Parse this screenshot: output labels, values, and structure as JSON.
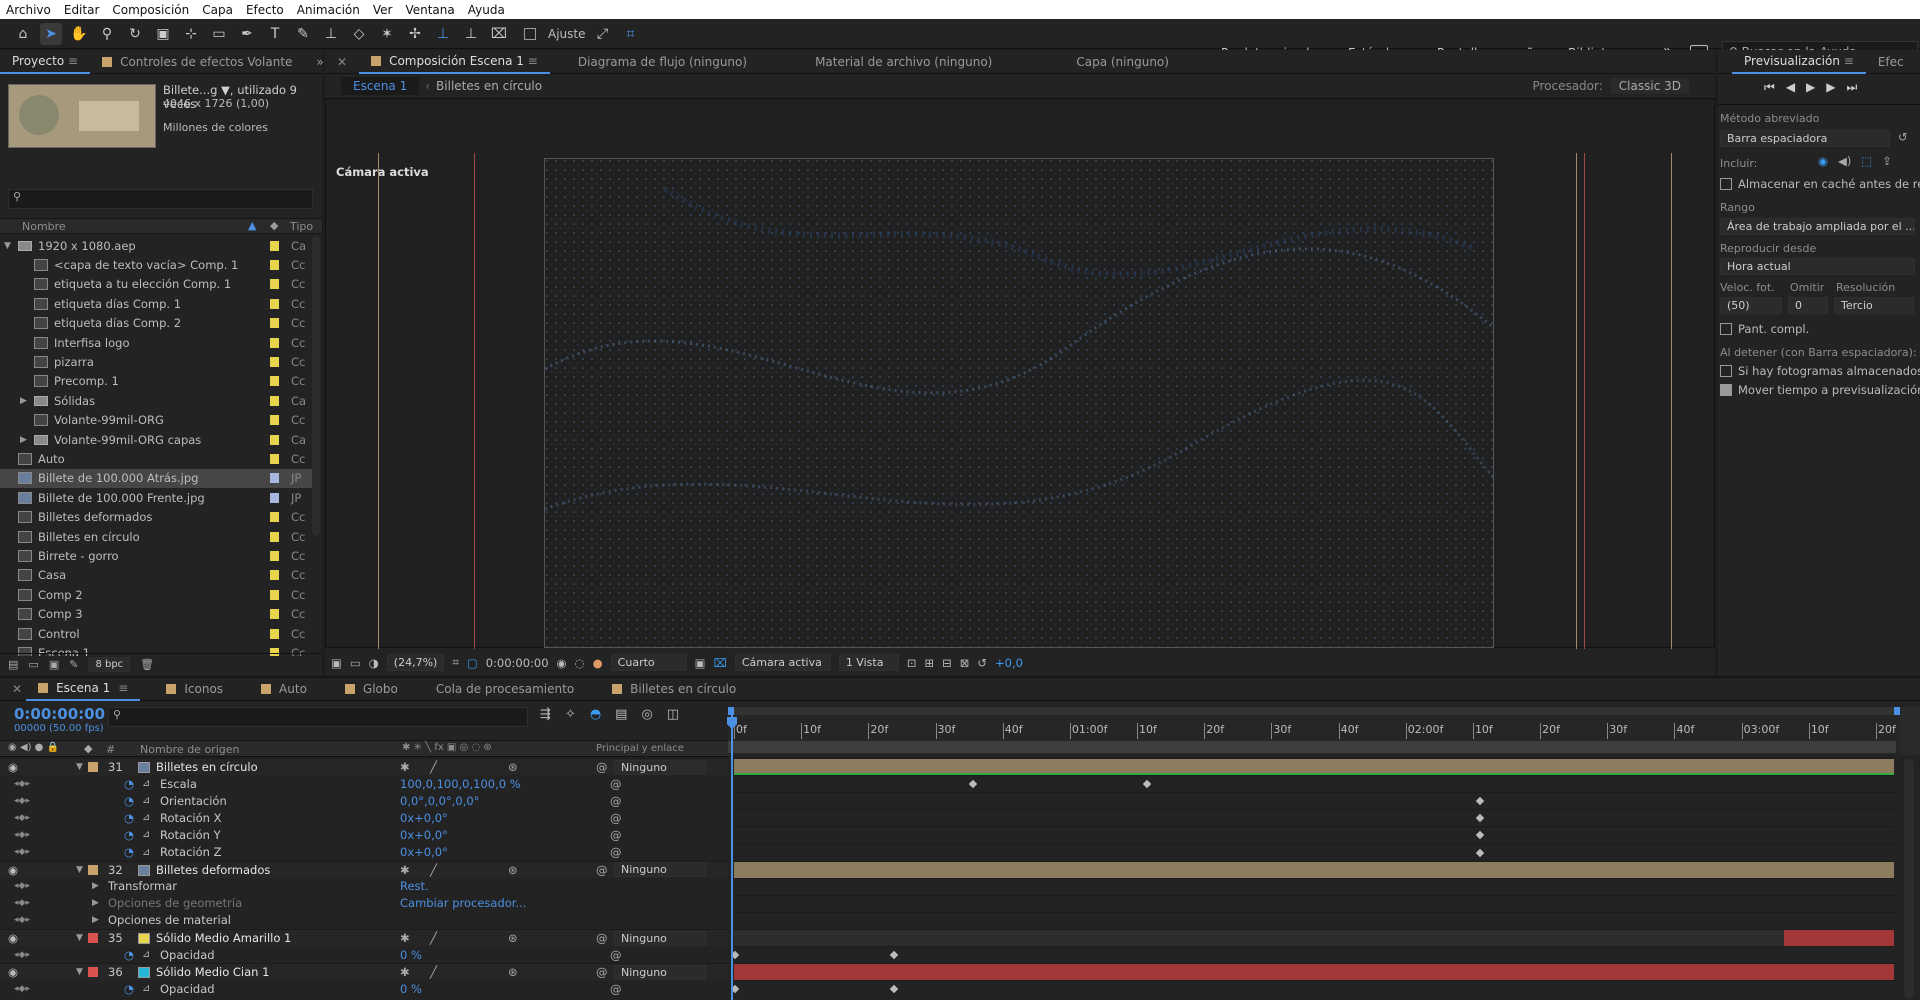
{
  "menu": [
    "Archivo",
    "Editar",
    "Composición",
    "Capa",
    "Efecto",
    "Animación",
    "Ver",
    "Ventana",
    "Ayuda"
  ],
  "toolbar": {
    "snap_label": "Ajuste",
    "workspaces": [
      "Predeterminado",
      "Estándar",
      "Pantalla pequeña",
      "Bibliotecas"
    ],
    "search_placeholder": "Buscar en la Ayuda"
  },
  "project": {
    "tabs": [
      "Proyecto",
      "Controles de efectos Volante"
    ],
    "item_name": "Billete...g ▼, utilizado 9 veces",
    "item_size": "4046 x 1726 (1,00)",
    "item_colors": "Millones de colores",
    "col_name": "Nombre",
    "col_type": "Tipo",
    "bpc": "8 bpc",
    "items": [
      {
        "name": "1920 x 1080.aep",
        "type": "Ca",
        "indent": 0,
        "kind": "folder",
        "color": "#e8d44d",
        "expand": "open"
      },
      {
        "name": "<capa de texto vacía> Comp. 1",
        "type": "Cc",
        "indent": 1,
        "kind": "comp",
        "color": "#e8d44d"
      },
      {
        "name": "etiqueta a tu elección Comp. 1",
        "type": "Cc",
        "indent": 1,
        "kind": "comp",
        "color": "#e8d44d"
      },
      {
        "name": "etiqueta días Comp. 1",
        "type": "Cc",
        "indent": 1,
        "kind": "comp",
        "color": "#e8d44d"
      },
      {
        "name": "etiqueta días Comp. 2",
        "type": "Cc",
        "indent": 1,
        "kind": "comp",
        "color": "#e8d44d"
      },
      {
        "name": "Interfisa logo",
        "type": "Cc",
        "indent": 1,
        "kind": "comp",
        "color": "#e8d44d"
      },
      {
        "name": "pizarra",
        "type": "Cc",
        "indent": 1,
        "kind": "comp",
        "color": "#e8d44d"
      },
      {
        "name": "Precomp. 1",
        "type": "Cc",
        "indent": 1,
        "kind": "comp",
        "color": "#e8d44d"
      },
      {
        "name": "Sólidas",
        "type": "Ca",
        "indent": 1,
        "kind": "folder",
        "color": "#e8d44d",
        "expand": "closed"
      },
      {
        "name": "Volante-99mil-ORG",
        "type": "Cc",
        "indent": 1,
        "kind": "comp",
        "color": "#e8d44d"
      },
      {
        "name": "Volante-99mil-ORG capas",
        "type": "Ca",
        "indent": 1,
        "kind": "folder",
        "color": "#e8d44d",
        "expand": "closed"
      },
      {
        "name": "Auto",
        "type": "Cc",
        "indent": 0,
        "kind": "comp",
        "color": "#e8d44d"
      },
      {
        "name": "Billete de 100.000 Atrás.jpg",
        "type": "JP",
        "indent": 0,
        "kind": "img",
        "color": "#a8b6e0",
        "selected": true
      },
      {
        "name": "Billete de 100.000 Frente.jpg",
        "type": "JP",
        "indent": 0,
        "kind": "img",
        "color": "#a8b6e0"
      },
      {
        "name": "Billetes deformados",
        "type": "Cc",
        "indent": 0,
        "kind": "comp",
        "color": "#e8d44d"
      },
      {
        "name": "Billetes en círculo",
        "type": "Cc",
        "indent": 0,
        "kind": "comp",
        "color": "#e8d44d"
      },
      {
        "name": "Birrete - gorro",
        "type": "Cc",
        "indent": 0,
        "kind": "comp",
        "color": "#e8d44d"
      },
      {
        "name": "Casa",
        "type": "Cc",
        "indent": 0,
        "kind": "comp",
        "color": "#e8d44d"
      },
      {
        "name": "Comp 2",
        "type": "Cc",
        "indent": 0,
        "kind": "comp",
        "color": "#e8d44d"
      },
      {
        "name": "Comp 3",
        "type": "Cc",
        "indent": 0,
        "kind": "comp",
        "color": "#e8d44d"
      },
      {
        "name": "Control",
        "type": "Cc",
        "indent": 0,
        "kind": "comp",
        "color": "#e8d44d"
      },
      {
        "name": "Escena 1",
        "type": "Cc",
        "indent": 0,
        "kind": "comp",
        "color": "#e8d44d"
      }
    ]
  },
  "viewer": {
    "tabs": [
      "Composición Escena 1",
      "Diagrama de flujo (ninguno)",
      "Material de archivo (ninguno)",
      "Capa (ninguno)"
    ],
    "breadcrumbs": [
      "Escena 1",
      "Billetes en círculo"
    ],
    "renderer_label": "Procesador:",
    "renderer_value": "Classic 3D",
    "camera_label": "Cámara activa",
    "zoom": "(24,7%)",
    "timecode": "0:00:00:00",
    "resolution": "Cuarto",
    "camera_select": "Cámara activa",
    "views": "1 Vista",
    "exposure": "+0,0",
    "canvas_color": "#3d6eb0"
  },
  "preview": {
    "tabs": [
      "Previsualización",
      "Efec"
    ],
    "shortcut_label": "Método abreviado",
    "shortcut_value": "Barra espaciadora",
    "include_label": "Incluir:",
    "cache_label": "Almacenar en caché antes de reprod",
    "range_label": "Rango",
    "range_value": "Área de trabajo ampliada por el ...",
    "play_from_label": "Reproducir desde",
    "play_from_value": "Hora actual",
    "fps_label": "Veloc. fot.",
    "skip_label": "Omitir",
    "res_label": "Resolución",
    "fps_value": "(50)",
    "skip_value": "0",
    "res_value": "Tercio",
    "fullscreen_label": "Pant. compl.",
    "on_stop_label": "Al detener (con Barra espaciadora):",
    "if_cached_label": "Si hay fotogramas almacenados, repr",
    "move_time_label": "Mover tiempo a previsualización"
  },
  "timeline": {
    "tabs": [
      "Escena 1",
      "Iconos",
      "Auto",
      "Globo",
      "Cola de procesamiento",
      "Billetes en círculo"
    ],
    "tab_colors": [
      "#c9a36b",
      "#c9a36b",
      "#c9a36b",
      "#c9a36b",
      "",
      "#c9a36b"
    ],
    "timecode": "0:00:00:00",
    "frame_info": "00000 (50.00 fps)",
    "col_source": "Nombre de origen",
    "col_parent": "Principal y enlace",
    "ruler": [
      "0f",
      "10f",
      "20f",
      "30f",
      "40f",
      "01:00f",
      "10f",
      "20f",
      "30f",
      "40f",
      "02:00f",
      "10f",
      "20f",
      "30f",
      "40f",
      "03:00f",
      "10f",
      "20f"
    ],
    "rows": [
      {
        "type": "layer",
        "num": "31",
        "name": "Billetes en círculo",
        "color": "#c9a36b",
        "icon": "comp",
        "parent": "Ninguno",
        "bar": "#8b7d5e"
      },
      {
        "type": "prop",
        "name": "Escala",
        "value": "100,0,100,0,100,0 %",
        "kf": [
          0.205,
          0.355
        ]
      },
      {
        "type": "prop",
        "name": "Orientación",
        "value": "0,0°,0,0°,0,0°",
        "kf": [
          0.642
        ]
      },
      {
        "type": "prop",
        "name": "Rotación X",
        "value": "0x+0,0°",
        "kf": [
          0.642
        ]
      },
      {
        "type": "prop",
        "name": "Rotación Y",
        "value": "0x+0,0°",
        "kf": [
          0.642
        ]
      },
      {
        "type": "prop",
        "name": "Rotación Z",
        "value": "0x+0,0°",
        "kf": [
          0.642
        ]
      },
      {
        "type": "layer",
        "num": "32",
        "name": "Billetes deformados",
        "color": "#c9a36b",
        "icon": "comp",
        "parent": "Ninguno",
        "bar": "#8b7d5e"
      },
      {
        "type": "group",
        "name": "Transformar",
        "value": "Rest."
      },
      {
        "type": "group",
        "name": "Opciones de geometría",
        "value": "Cambiar procesador...",
        "dim": true
      },
      {
        "type": "group",
        "name": "Opciones de material",
        "value": ""
      },
      {
        "type": "layer",
        "num": "35",
        "name": "Sólido Medio Amarillo 1",
        "color": "#d9534f",
        "icon": "solid-yellow",
        "parent": "Ninguno",
        "bar": "#2d2d2d"
      },
      {
        "type": "prop",
        "name": "Opacidad",
        "value": "0 %",
        "kf": [
          0.0,
          0.137
        ]
      },
      {
        "type": "layer",
        "num": "36",
        "name": "Sólido Medio Cian 1",
        "color": "#d9534f",
        "icon": "solid-cyan",
        "parent": "Ninguno",
        "bar": "#a33838"
      },
      {
        "type": "prop",
        "name": "Opacidad",
        "value": "0 %",
        "kf": [
          0.0,
          0.137
        ]
      }
    ]
  }
}
